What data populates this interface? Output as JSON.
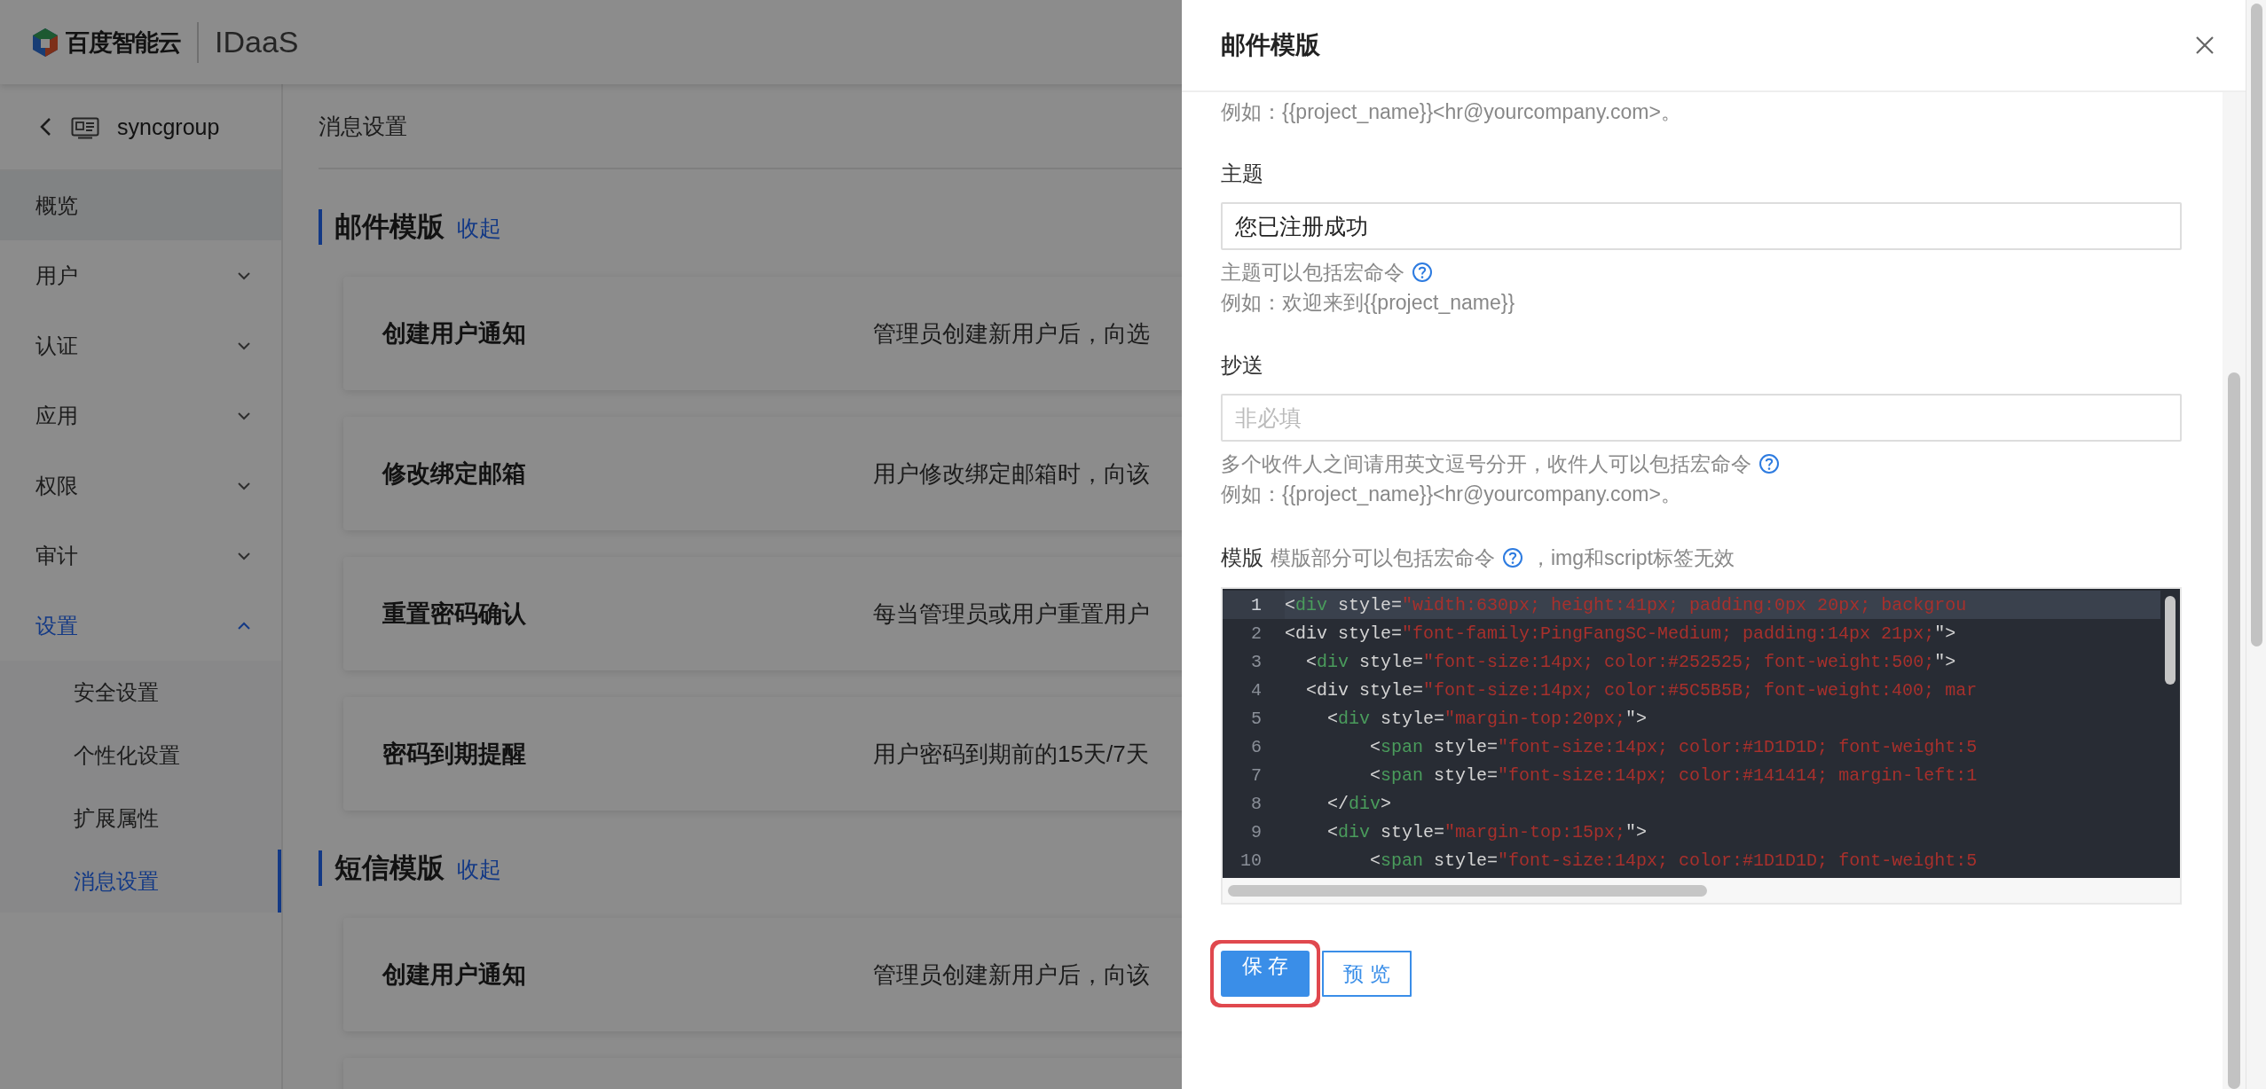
{
  "header": {
    "logo_text": "百度智能云",
    "product": "IDaaS"
  },
  "sidebar": {
    "title": "syncgroup",
    "items": [
      {
        "kind": "link",
        "label": "概览",
        "selected": false,
        "hovered": true
      },
      {
        "kind": "group",
        "label": "用户",
        "selected": false,
        "hovered": false,
        "expanded": false
      },
      {
        "kind": "group",
        "label": "认证",
        "selected": false,
        "hovered": false,
        "expanded": false
      },
      {
        "kind": "group",
        "label": "应用",
        "selected": false,
        "hovered": false,
        "expanded": false
      },
      {
        "kind": "group",
        "label": "权限",
        "selected": false,
        "hovered": false,
        "expanded": false
      },
      {
        "kind": "group",
        "label": "审计",
        "selected": false,
        "hovered": false,
        "expanded": false
      },
      {
        "kind": "group",
        "label": "设置",
        "selected": false,
        "hovered": false,
        "expanded": true,
        "children": [
          {
            "label": "安全设置",
            "selected": false
          },
          {
            "label": "个性化设置",
            "selected": false
          },
          {
            "label": "扩展属性",
            "selected": false
          },
          {
            "label": "消息设置",
            "selected": true
          }
        ]
      }
    ]
  },
  "main": {
    "breadcrumb": "消息设置",
    "sections": [
      {
        "title": "邮件模版",
        "toggle": "收起",
        "cards": [
          {
            "kind": "card",
            "title": "创建用户通知",
            "description": "管理员创建新用户后，向选"
          },
          {
            "kind": "card",
            "title": "修改绑定邮箱",
            "description": "用户修改绑定邮箱时，向该"
          },
          {
            "kind": "card",
            "title": "重置密码确认",
            "description": "每当管理员或用户重置用户"
          },
          {
            "kind": "card",
            "title": "密码到期提醒",
            "description": "用户密码到期前的15天/7天"
          }
        ]
      },
      {
        "title": "短信模版",
        "toggle": "收起",
        "cards": [
          {
            "kind": "card",
            "title": "创建用户通知",
            "description": "管理员创建新用户后，向该"
          },
          {
            "kind": "partial"
          }
        ]
      }
    ]
  },
  "drawer": {
    "title": "邮件模版",
    "scrolled_hint": "例如：{{project_name}}<hr@yourcompany.com>。",
    "subject": {
      "label": "主题",
      "value": "您已注册成功",
      "help": "主题可以包括宏命令",
      "example": "例如：欢迎来到{{project_name}}"
    },
    "cc": {
      "label": "抄送",
      "placeholder": "非必填",
      "help": "多个收件人之间请用英文逗号分开，收件人可以包括宏命令",
      "example": "例如：{{project_name}}<hr@yourcompany.com>。"
    },
    "template": {
      "label": "模版",
      "help": "模版部分可以包括宏命令",
      "help_after": "，img和script标签无效",
      "lines": [
        {
          "number": "1",
          "active": true,
          "tokens": [
            {
              "kind": "punct",
              "text": "<"
            },
            {
              "kind": "tag",
              "text": "div"
            },
            {
              "kind": "attr",
              "text": " style="
            },
            {
              "kind": "string",
              "text": "\"width:630px; height:41px; padding:0px 20px; backgrou"
            }
          ]
        },
        {
          "number": "2",
          "active": false,
          "tokens": [
            {
              "kind": "attr",
              "text": "<div style="
            },
            {
              "kind": "string",
              "text": "\"font-family:PingFangSC-Medium; padding:14px 21px;"
            },
            {
              "kind": "punct",
              "text": "\">"
            }
          ]
        },
        {
          "number": "3",
          "active": false,
          "tokens": [
            {
              "kind": "punct",
              "text": "  <"
            },
            {
              "kind": "tag",
              "text": "div"
            },
            {
              "kind": "attr",
              "text": " style="
            },
            {
              "kind": "string",
              "text": "\"font-size:14px; color:#252525; font-weight:500;"
            },
            {
              "kind": "punct",
              "text": "\">"
            }
          ]
        },
        {
          "number": "4",
          "active": false,
          "tokens": [
            {
              "kind": "attr",
              "text": "  <div style="
            },
            {
              "kind": "string",
              "text": "\"font-size:14px; color:#5C5B5B; font-weight:400; mar"
            }
          ]
        },
        {
          "number": "5",
          "active": false,
          "tokens": [
            {
              "kind": "punct",
              "text": "    <"
            },
            {
              "kind": "tag",
              "text": "div"
            },
            {
              "kind": "attr",
              "text": " style="
            },
            {
              "kind": "string",
              "text": "\"margin-top:20px;"
            },
            {
              "kind": "punct",
              "text": "\">"
            }
          ]
        },
        {
          "number": "6",
          "active": false,
          "tokens": [
            {
              "kind": "punct",
              "text": "        <"
            },
            {
              "kind": "tag",
              "text": "span"
            },
            {
              "kind": "attr",
              "text": " style="
            },
            {
              "kind": "string",
              "text": "\"font-size:14px; color:#1D1D1D; font-weight:5"
            }
          ]
        },
        {
          "number": "7",
          "active": false,
          "tokens": [
            {
              "kind": "punct",
              "text": "        <"
            },
            {
              "kind": "tag",
              "text": "span"
            },
            {
              "kind": "attr",
              "text": " style="
            },
            {
              "kind": "string",
              "text": "\"font-size:14px; color:#141414; margin-left:1"
            }
          ]
        },
        {
          "number": "8",
          "active": false,
          "tokens": [
            {
              "kind": "punct",
              "text": "    </"
            },
            {
              "kind": "tag",
              "text": "div"
            },
            {
              "kind": "punct",
              "text": ">"
            }
          ]
        },
        {
          "number": "9",
          "active": false,
          "tokens": [
            {
              "kind": "punct",
              "text": "    <"
            },
            {
              "kind": "tag",
              "text": "div"
            },
            {
              "kind": "attr",
              "text": " style="
            },
            {
              "kind": "string",
              "text": "\"margin-top:15px;"
            },
            {
              "kind": "punct",
              "text": "\">"
            }
          ]
        },
        {
          "number": "10",
          "active": false,
          "tokens": [
            {
              "kind": "punct",
              "text": "        <"
            },
            {
              "kind": "tag",
              "text": "span"
            },
            {
              "kind": "attr",
              "text": " style="
            },
            {
              "kind": "string",
              "text": "\"font-size:14px; color:#1D1D1D; font-weight:5"
            }
          ]
        }
      ]
    },
    "buttons": [
      {
        "kind": "primary",
        "label": "保 存",
        "highlighted": true
      },
      {
        "kind": "default",
        "label": "预 览",
        "highlighted": false
      }
    ]
  }
}
